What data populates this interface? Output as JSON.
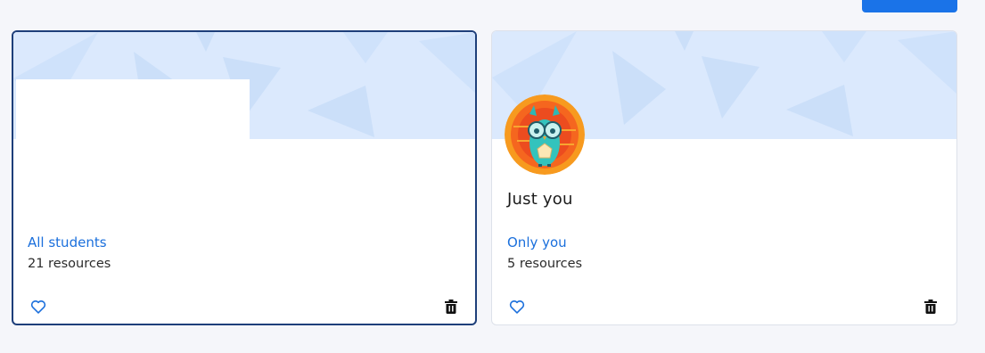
{
  "colors": {
    "accent": "#1a73e8",
    "link": "#1a6fdc",
    "banner_bg": "#dbe9fd",
    "banner_shape": "#cbdff9",
    "selected_border": "#1e3f7a"
  },
  "cards": [
    {
      "title": "",
      "audience": "All students",
      "resource_count": "21 resources",
      "selected": true,
      "icons": [
        "heart-outline-icon",
        "trash-icon"
      ]
    },
    {
      "title": "Just you",
      "audience": "Only you",
      "resource_count": "5 resources",
      "selected": false,
      "avatar": "owl-avatar",
      "icons": [
        "heart-outline-icon",
        "trash-icon"
      ]
    }
  ]
}
